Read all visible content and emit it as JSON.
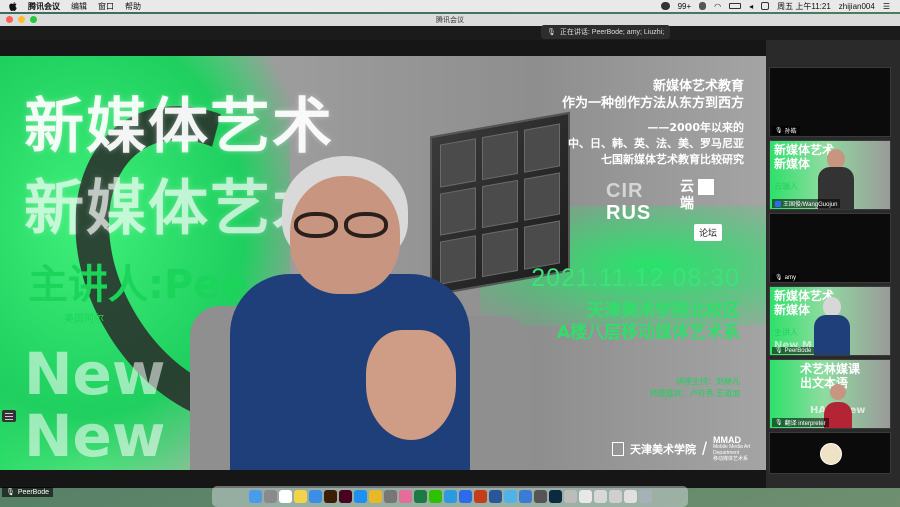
{
  "menubar": {
    "app_name": "腾讯会议",
    "menus": [
      "编辑",
      "窗口",
      "帮助"
    ],
    "status": {
      "wechat_badge": "99+",
      "clock": "周五 上午11:21",
      "user": "zhijian004"
    }
  },
  "window": {
    "title": "腾讯会议",
    "speaking_text": "正在讲话: PeerBode; amy; Liuzhi;",
    "stage_speaker": "PeerBode"
  },
  "slide": {
    "big_title_1": "新媒体艺术",
    "big_title_2": "新媒体艺术化",
    "speaker_label": "主讲人:Pee",
    "speaker_sub": "美国阿尔",
    "new_m_1": "New M",
    "new_m_2": "New M",
    "right_lines": [
      "新媒体艺术教育",
      "作为一种创作方法从东方到西方"
    ],
    "right_lines_2": [
      "——2000年以来的",
      "中、日、韩、英、法、美、罗马尼亚",
      "七国新媒体艺术教育比较研究"
    ],
    "cirrus_1": "CIR",
    "cirrus_2": "RUS",
    "yun_1": "云",
    "yun_2": "端",
    "luntan": "论坛",
    "date": "2021.11.12  08:30",
    "venue_1": "天津美术学院北校区",
    "venue_2": "A楼八层移动媒体艺术系",
    "host_1": "讲座主持：刘林凡",
    "host_2": "特邀嘉宾：卢玲秀  王道加",
    "school_name": "天津美术学院",
    "mmad": "MMAD",
    "mmad_sub_1": "Mobile Media Art",
    "mmad_sub_2": "Department",
    "mmad_sub_3": "移动媒体艺术系"
  },
  "panel": {
    "tiles": [
      {
        "name": "孙皓"
      },
      {
        "name": "王国俊/WangGuojun",
        "mini_text_1": "新媒体艺术",
        "mini_text_2": "新媒体",
        "mini_green": "云端人"
      },
      {
        "name": "amy"
      },
      {
        "name": "PeerBode",
        "mini_text_1": "新媒体艺术",
        "mini_text_2": "新媒体",
        "mini_green": "主讲人",
        "extra": "New M"
      },
      {
        "name": "翻译 interpreter",
        "mini_text_1": "术艺林媒课",
        "mini_text_2": "出文本语",
        "extra": "HAM Mew"
      },
      {
        "name": ""
      }
    ]
  },
  "colors": {
    "accent_green": "#2ee06a",
    "slide_grey": "#9d9d9d",
    "panel_bg": "#2a2a2a"
  }
}
